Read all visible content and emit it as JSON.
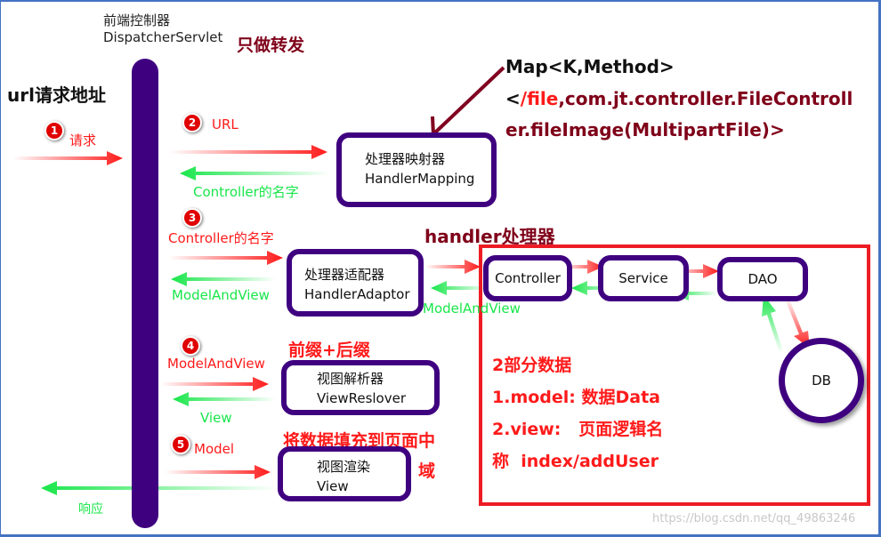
{
  "colors": {
    "frame": "#4472c4",
    "bus": "#3f0080",
    "node_border": "#3f0080",
    "request_arrow": "#ff1a1a",
    "response_arrow": "#19e64a",
    "handler_box": "#ed1c24",
    "annotation_dark_red": "#7f0019",
    "mapping_pointer": "#800020"
  },
  "dispatcher": {
    "title_cn": "前端控制器",
    "title_en": "DispatcherServlet",
    "note": "只做转发"
  },
  "client": {
    "label": "url请求地址",
    "response_label": "响应"
  },
  "steps": [
    {
      "number": "1",
      "request_label": "请求"
    },
    {
      "number": "2",
      "request_label": "URL",
      "response_label": "Controller的名字"
    },
    {
      "number": "3",
      "request_label": "Controller的名字",
      "response_label": "ModelAndView"
    },
    {
      "number": "4",
      "request_label": "ModelAndView",
      "response_label": "View"
    },
    {
      "number": "5",
      "request_label": "Model"
    }
  ],
  "nodes": {
    "handler_mapping": {
      "cn": "处理器映射器",
      "en": "HandlerMapping"
    },
    "handler_adaptor": {
      "cn": "处理器适配器",
      "en": "HandlerAdaptor"
    },
    "view_resolver": {
      "cn": "视图解析器",
      "en": "ViewReslover"
    },
    "view_render": {
      "cn": "视图渲染",
      "en": "View"
    },
    "controller": "Controller",
    "service": "Service",
    "dao": "DAO",
    "db": "DB"
  },
  "annotations": {
    "map_line1": "Map<K,Method>",
    "map_line2_prefix": "<",
    "map_line2_key": "/file",
    "map_line2_rest": ",com.jt.controller.FileControll",
    "map_line3": "er.fileImage(MultipartFile)>",
    "handler_title": "handler处理器",
    "adaptor_return": "ModelAndView",
    "prefix_suffix": "前缀+后缀",
    "fill_data_line1": "将数据填充到页面中",
    "fill_data_line2": "域"
  },
  "data_parts": {
    "title": "2部分数据",
    "model": "1.model: 数据Data",
    "view_line1": "2.view:   页面逻辑名",
    "view_line2": "称  index/addUser"
  },
  "watermark": "https://blog.csdn.net/qq_49863246"
}
